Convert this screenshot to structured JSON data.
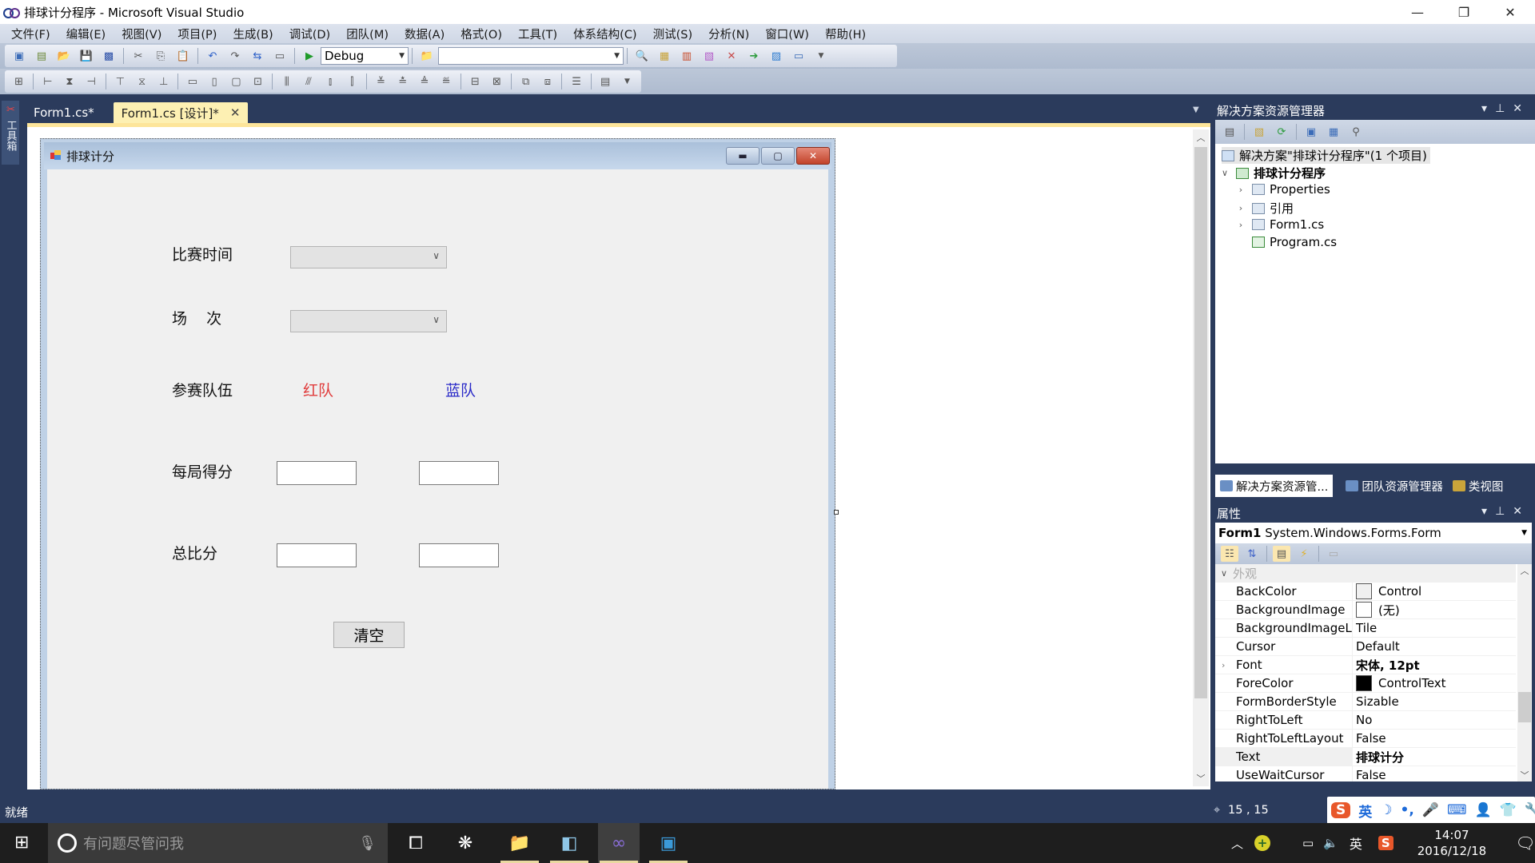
{
  "window": {
    "title": "排球计分程序 - Microsoft Visual Studio",
    "controls": {
      "minimize": "—",
      "restore": "❐",
      "close": "✕"
    }
  },
  "menu": [
    "文件(F)",
    "编辑(E)",
    "视图(V)",
    "项目(P)",
    "生成(B)",
    "调试(D)",
    "团队(M)",
    "数据(A)",
    "格式(O)",
    "工具(T)",
    "体系结构(C)",
    "测试(S)",
    "分析(N)",
    "窗口(W)",
    "帮助(H)"
  ],
  "toolbar": {
    "config_combo": "Debug",
    "target_combo": "",
    "icons": [
      "new-project-icon",
      "add-item-icon",
      "open-icon",
      "save-icon",
      "save-all-icon",
      "cut-icon",
      "copy-icon",
      "paste-icon",
      "undo-icon",
      "redo-icon",
      "navigate-icon",
      "find-icon",
      "start-debug-icon",
      "solution-folder-icon",
      "solution-explorer-icon",
      "properties-icon",
      "object-browser-icon",
      "toolbox-icon",
      "tools-icon",
      "start-page-icon",
      "team-icon",
      "output-icon"
    ]
  },
  "toolbox_tab": "工具箱",
  "tabs": [
    {
      "label": "Form1.cs*",
      "active": false
    },
    {
      "label": "Form1.cs [设计]*",
      "active": true,
      "close": "✕"
    }
  ],
  "form": {
    "title": "排球计分",
    "labels": {
      "match_time": "比赛时间",
      "round": "场    次",
      "teams": "参赛队伍",
      "red_team": "红队",
      "blue_team": "蓝队",
      "set_score": "每局得分",
      "total_score": "总比分"
    },
    "colors": {
      "red_team": "#e03a3a",
      "blue_team": "#2a2ac8"
    },
    "match_time_value": "",
    "round_value": "",
    "red_set_score": "",
    "blue_set_score": "",
    "red_total": "",
    "blue_total": "",
    "clear_button": "清空"
  },
  "solution_explorer": {
    "title": "解决方案资源管理器",
    "tree": [
      {
        "label": "解决方案\"排球计分程序\"(1 个项目)",
        "level": 0
      },
      {
        "label": "排球计分程序",
        "level": 1,
        "expanded": true,
        "bold": true
      },
      {
        "label": "Properties",
        "level": 2,
        "expandable": true
      },
      {
        "label": "引用",
        "level": 2,
        "expandable": true
      },
      {
        "label": "Form1.cs",
        "level": 2,
        "expandable": true
      },
      {
        "label": "Program.cs",
        "level": 2,
        "expandable": false
      }
    ],
    "bottom_tabs": [
      "解决方案资源管...",
      "团队资源管理器",
      "类视图"
    ]
  },
  "properties": {
    "title": "属性",
    "object_name": "Form1",
    "object_type": "System.Windows.Forms.Form",
    "category": "外观",
    "rows": [
      {
        "name": "BackColor",
        "value": "Control",
        "swatch": "#f0f0f0"
      },
      {
        "name": "BackgroundImage",
        "value": "(无)",
        "swatch": "#ffffff"
      },
      {
        "name": "BackgroundImageLayout",
        "value": "Tile"
      },
      {
        "name": "Cursor",
        "value": "Default"
      },
      {
        "name": "Font",
        "value": "宋体, 12pt",
        "bold": true,
        "expandable": true
      },
      {
        "name": "ForeColor",
        "value": "ControlText",
        "swatch": "#000000"
      },
      {
        "name": "FormBorderStyle",
        "value": "Sizable"
      },
      {
        "name": "RightToLeft",
        "value": "No"
      },
      {
        "name": "RightToLeftLayout",
        "value": "False"
      },
      {
        "name": "Text",
        "value": "排球计分",
        "bold": true,
        "selected": true
      },
      {
        "name": "UseWaitCursor",
        "value": "False"
      }
    ]
  },
  "statusbar": {
    "status": "就绪",
    "position": "15 , 15"
  },
  "ime_bar": [
    "S",
    "英",
    "☽",
    "•,",
    "🎤",
    "⌨",
    "👤",
    "👕",
    "🔧"
  ],
  "taskbar": {
    "search_placeholder": "有问题尽管问我",
    "clock_time": "14:07",
    "clock_date": "2016/12/18",
    "ime_lang": "英"
  }
}
